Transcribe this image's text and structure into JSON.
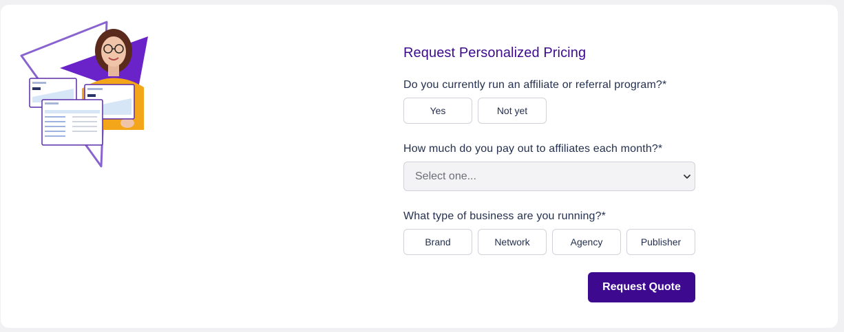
{
  "colors": {
    "accent": "#3d0a8f",
    "title": "#3d0a8f",
    "border": "#cfd2d8",
    "select_bg": "#f3f3f5",
    "page_bg": "#f1f1f3"
  },
  "hero": {
    "image": "woman-with-dashboard-illustration",
    "icons": [
      "triangle-outline-icon",
      "purple-triangle-icon",
      "dashboard-card-icon"
    ]
  },
  "form": {
    "title": "Request Personalized Pricing",
    "q1": {
      "label": "Do you currently run an affiliate or referral program?*",
      "options": [
        "Yes",
        "Not yet"
      ]
    },
    "q2": {
      "label": "How much do you pay out to affiliates each month?*",
      "select_value": "Select one...",
      "icon": "chevron-down-icon"
    },
    "q3": {
      "label": "What type of business are you running?*",
      "options": [
        "Brand",
        "Network",
        "Agency",
        "Publisher"
      ]
    },
    "submit_label": "Request Quote"
  }
}
